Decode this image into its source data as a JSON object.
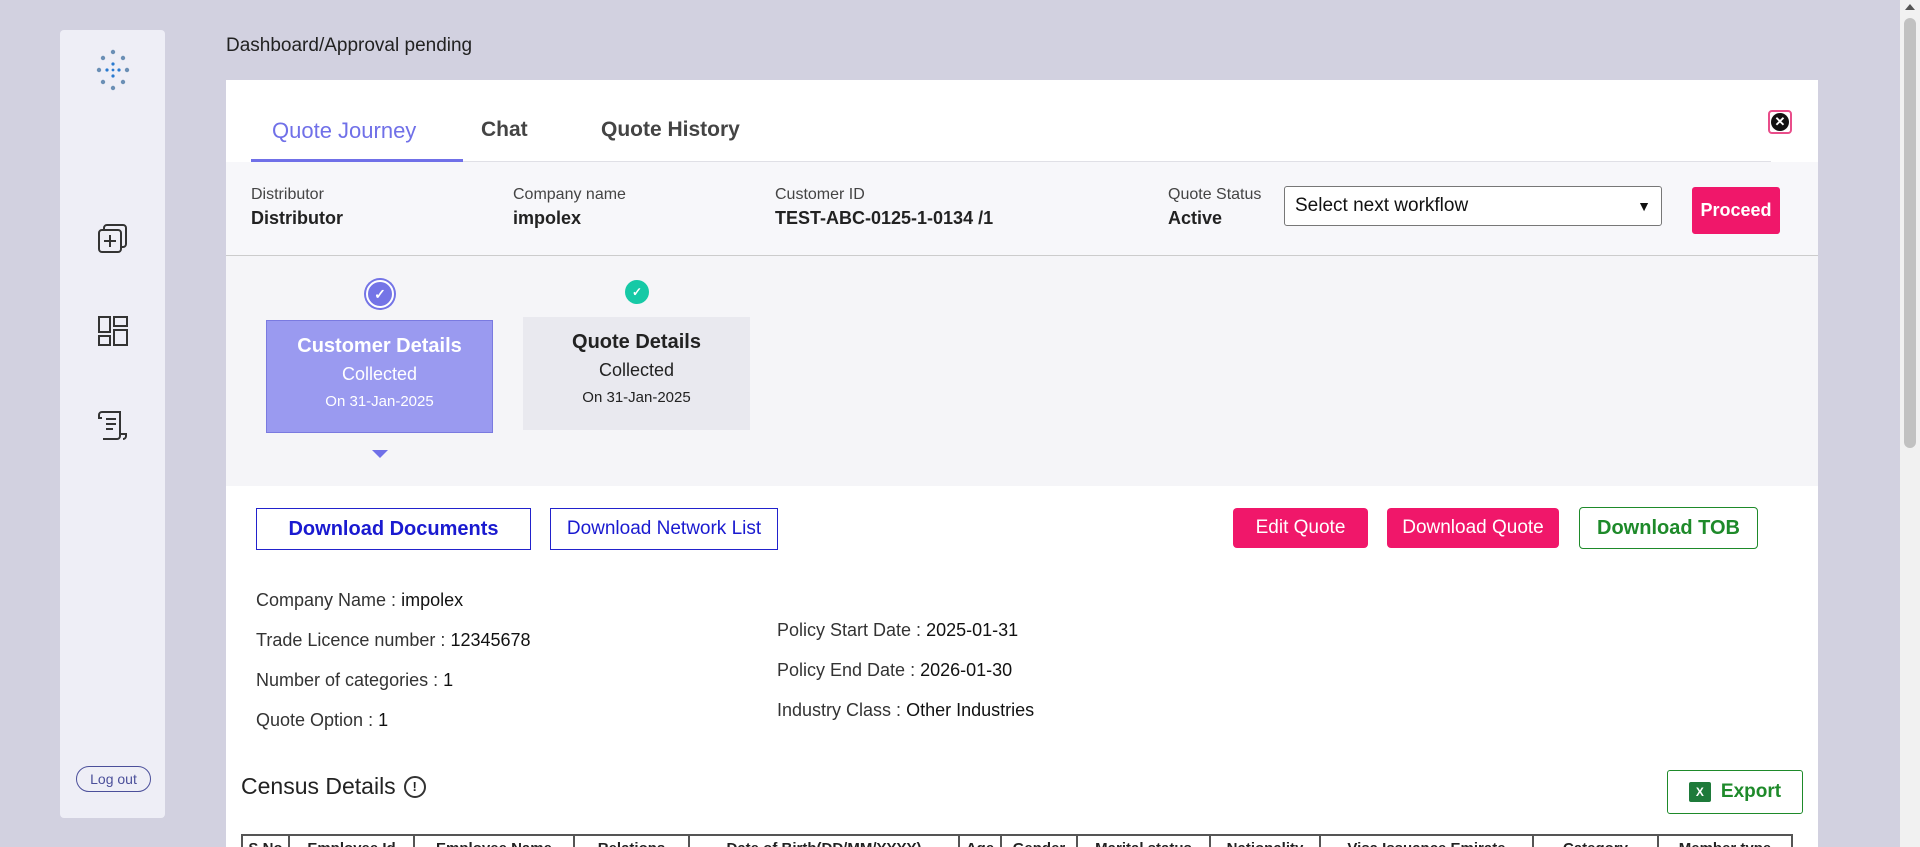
{
  "breadcrumb": "Dashboard/Approval pending",
  "sidebar": {
    "logout_label": "Log out"
  },
  "tabs": [
    {
      "label": "Quote Journey",
      "active": true
    },
    {
      "label": "Chat",
      "active": false
    },
    {
      "label": "Quote History",
      "active": false
    }
  ],
  "info": {
    "distributor_label": "Distributor",
    "distributor_value": "Distributor",
    "company_label": "Company name",
    "company_value": "impolex",
    "customer_label": "Customer ID",
    "customer_value": "TEST-ABC-0125-1-0134 /1",
    "status_label": "Quote Status",
    "status_value": "Active",
    "workflow_selected": "Select next workflow",
    "proceed_label": "Proceed"
  },
  "steps": [
    {
      "title": "Customer Details",
      "status": "Collected",
      "date": "On 31-Jan-2025"
    },
    {
      "title": "Quote Details",
      "status": "Collected",
      "date": "On 31-Jan-2025"
    }
  ],
  "actions": {
    "download_documents": "Download Documents",
    "download_network": "Download Network List",
    "edit_quote": "Edit Quote",
    "download_quote": "Download Quote",
    "download_tob": "Download TOB"
  },
  "details": {
    "company_name_label": "Company Name :",
    "company_name": "impolex",
    "trade_licence_label": "Trade Licence number :",
    "trade_licence": "12345678",
    "categories_label": "Number of categories :",
    "categories": "1",
    "quote_option_label": "Quote Option :",
    "quote_option": "1",
    "policy_start_label": "Policy Start Date :",
    "policy_start": "2025-01-31",
    "policy_end_label": "Policy End Date :",
    "policy_end": "2026-01-30",
    "industry_label": "Industry Class :",
    "industry": "Other Industries"
  },
  "census": {
    "title": "Census Details",
    "export_label": "Export",
    "columns": [
      "S.No",
      "Employee Id",
      "Employee Name",
      "Relations",
      "Date of Birth(DD/MM/YYYY)",
      "Age",
      "Gender",
      "Marital status",
      "Nationality",
      "Visa Issuance Emirate",
      "Category",
      "Member type"
    ]
  },
  "colors": {
    "accent": "#7070e8",
    "pink": "#f0176a",
    "green": "#1e8a2a"
  }
}
